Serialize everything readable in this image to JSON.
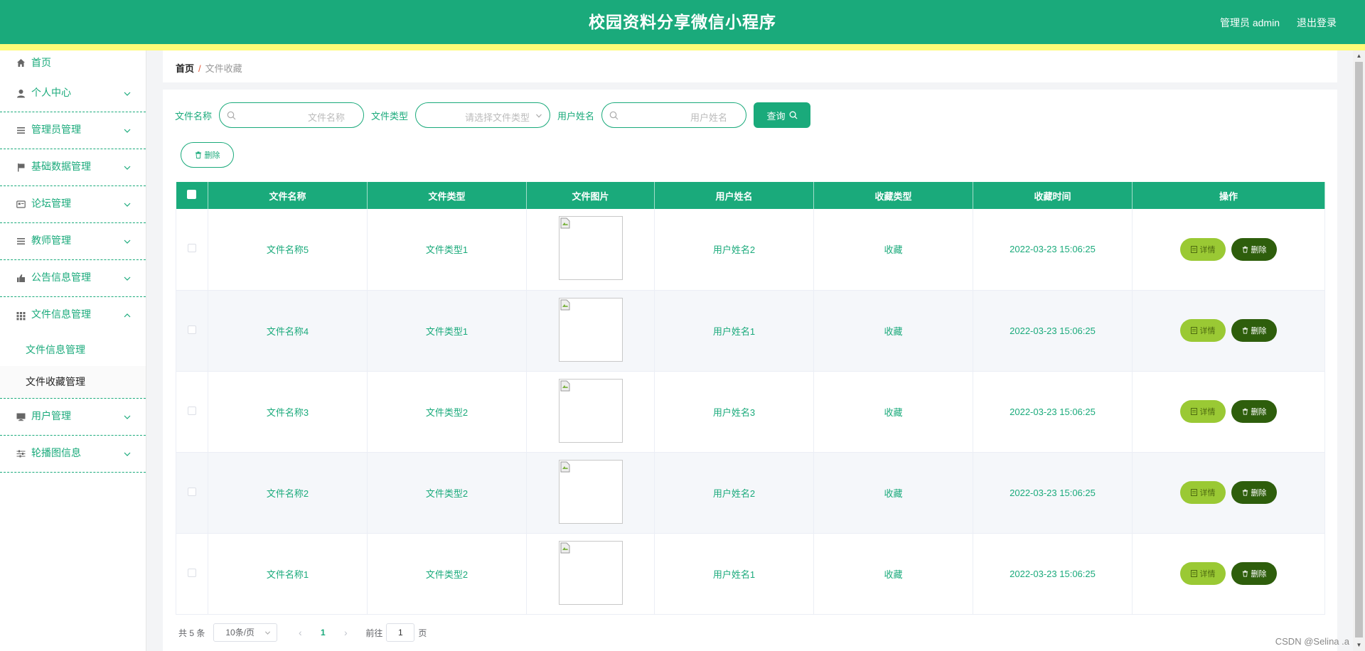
{
  "header": {
    "title": "校园资料分享微信小程序",
    "user": "管理员 admin",
    "logout": "退出登录"
  },
  "colors": {
    "primary": "#1aaa7b",
    "stripe": "#fffb78",
    "detail": "#9ac934",
    "delete": "#2e5e0c"
  },
  "sidebar": {
    "items": [
      {
        "label": "首页",
        "icon": "home-icon"
      },
      {
        "label": "个人中心",
        "icon": "user-icon"
      },
      {
        "label": "管理员管理",
        "icon": "list-icon"
      },
      {
        "label": "基础数据管理",
        "icon": "flag-icon"
      },
      {
        "label": "论坛管理",
        "icon": "card-icon"
      },
      {
        "label": "教师管理",
        "icon": "list-icon"
      },
      {
        "label": "公告信息管理",
        "icon": "thumb-icon"
      },
      {
        "label": "文件信息管理",
        "icon": "grid-icon"
      },
      {
        "label": "用户管理",
        "icon": "monitor-icon"
      },
      {
        "label": "轮播图信息",
        "icon": "sliders-icon"
      }
    ],
    "sub_items": [
      "文件信息管理",
      "文件收藏管理"
    ]
  },
  "breadcrumb": {
    "home": "首页",
    "separator": "/",
    "current": "文件收藏"
  },
  "search": {
    "file_name_label": "文件名称",
    "file_name_placeholder": "文件名称",
    "file_type_label": "文件类型",
    "file_type_placeholder": "请选择文件类型",
    "user_name_label": "用户姓名",
    "user_name_placeholder": "用户姓名",
    "query_button": "查询",
    "delete_button": "删除"
  },
  "table": {
    "columns": [
      "文件名称",
      "文件类型",
      "文件图片",
      "用户姓名",
      "收藏类型",
      "收藏时间",
      "操作"
    ],
    "rows": [
      {
        "file_name": "文件名称5",
        "file_type": "文件类型1",
        "user_name": "用户姓名2",
        "fav_type": "收藏",
        "time": "2022-03-23 15:06:25"
      },
      {
        "file_name": "文件名称4",
        "file_type": "文件类型1",
        "user_name": "用户姓名1",
        "fav_type": "收藏",
        "time": "2022-03-23 15:06:25"
      },
      {
        "file_name": "文件名称3",
        "file_type": "文件类型2",
        "user_name": "用户姓名3",
        "fav_type": "收藏",
        "time": "2022-03-23 15:06:25"
      },
      {
        "file_name": "文件名称2",
        "file_type": "文件类型2",
        "user_name": "用户姓名2",
        "fav_type": "收藏",
        "time": "2022-03-23 15:06:25"
      },
      {
        "file_name": "文件名称1",
        "file_type": "文件类型2",
        "user_name": "用户姓名1",
        "fav_type": "收藏",
        "time": "2022-03-23 15:06:25"
      }
    ],
    "detail_label": "详情",
    "delete_label": "删除"
  },
  "pagination": {
    "total": "共 5 条",
    "page_size": "10条/页",
    "prev": "‹",
    "current_page": "1",
    "next": "›",
    "goto_prefix": "前往",
    "goto_value": "1",
    "goto_suffix": "页"
  },
  "watermark": "CSDN @Selina .a"
}
